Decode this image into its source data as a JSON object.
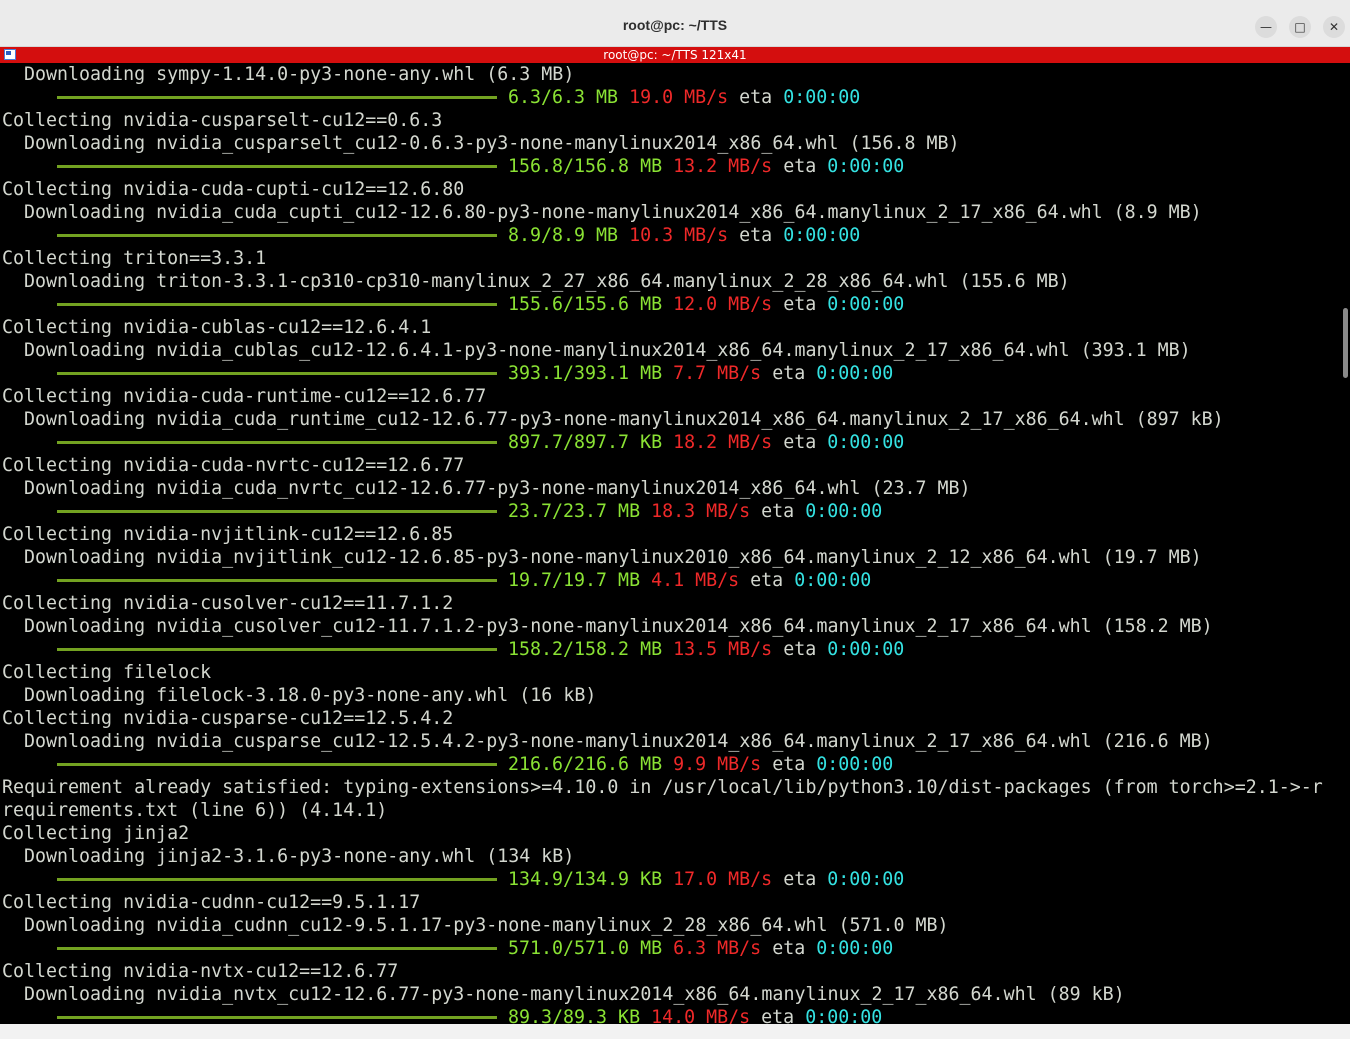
{
  "window": {
    "title": "root@pc: ~/TTS",
    "minimize_symbol": "—",
    "maximize_symbol": "□",
    "close_symbol": "✕"
  },
  "tab": {
    "title": "root@pc: ~/TTS 121x41"
  },
  "colors": {
    "terminal_bg": "#000000",
    "text": "#d3d7cf",
    "progress_green": "#73a221",
    "size_green": "#8ae234",
    "speed_red": "#ef2929",
    "eta_cyan": "#34e2e2",
    "tab_red": "#d40e0e"
  },
  "lines": [
    {
      "type": "text",
      "text": "  Downloading sympy-1.14.0-py3-none-any.whl (6.3 MB)"
    },
    {
      "type": "progress",
      "size": "6.3/6.3 MB",
      "speed": "19.0 MB/s",
      "eta_label": "eta",
      "eta": "0:00:00"
    },
    {
      "type": "text",
      "text": "Collecting nvidia-cusparselt-cu12==0.6.3"
    },
    {
      "type": "text",
      "text": "  Downloading nvidia_cusparselt_cu12-0.6.3-py3-none-manylinux2014_x86_64.whl (156.8 MB)"
    },
    {
      "type": "progress",
      "size": "156.8/156.8 MB",
      "speed": "13.2 MB/s",
      "eta_label": "eta",
      "eta": "0:00:00"
    },
    {
      "type": "text",
      "text": "Collecting nvidia-cuda-cupti-cu12==12.6.80"
    },
    {
      "type": "text",
      "text": "  Downloading nvidia_cuda_cupti_cu12-12.6.80-py3-none-manylinux2014_x86_64.manylinux_2_17_x86_64.whl (8.9 MB)"
    },
    {
      "type": "progress",
      "size": "8.9/8.9 MB",
      "speed": "10.3 MB/s",
      "eta_label": "eta",
      "eta": "0:00:00"
    },
    {
      "type": "text",
      "text": "Collecting triton==3.3.1"
    },
    {
      "type": "text",
      "text": "  Downloading triton-3.3.1-cp310-cp310-manylinux_2_27_x86_64.manylinux_2_28_x86_64.whl (155.6 MB)"
    },
    {
      "type": "progress",
      "size": "155.6/155.6 MB",
      "speed": "12.0 MB/s",
      "eta_label": "eta",
      "eta": "0:00:00"
    },
    {
      "type": "text",
      "text": "Collecting nvidia-cublas-cu12==12.6.4.1"
    },
    {
      "type": "text",
      "text": "  Downloading nvidia_cublas_cu12-12.6.4.1-py3-none-manylinux2014_x86_64.manylinux_2_17_x86_64.whl (393.1 MB)"
    },
    {
      "type": "progress",
      "size": "393.1/393.1 MB",
      "speed": "7.7 MB/s",
      "eta_label": "eta",
      "eta": "0:00:00"
    },
    {
      "type": "text",
      "text": "Collecting nvidia-cuda-runtime-cu12==12.6.77"
    },
    {
      "type": "text",
      "text": "  Downloading nvidia_cuda_runtime_cu12-12.6.77-py3-none-manylinux2014_x86_64.manylinux_2_17_x86_64.whl (897 kB)"
    },
    {
      "type": "progress",
      "size": "897.7/897.7 KB",
      "speed": "18.2 MB/s",
      "eta_label": "eta",
      "eta": "0:00:00"
    },
    {
      "type": "text",
      "text": "Collecting nvidia-cuda-nvrtc-cu12==12.6.77"
    },
    {
      "type": "text",
      "text": "  Downloading nvidia_cuda_nvrtc_cu12-12.6.77-py3-none-manylinux2014_x86_64.whl (23.7 MB)"
    },
    {
      "type": "progress",
      "size": "23.7/23.7 MB",
      "speed": "18.3 MB/s",
      "eta_label": "eta",
      "eta": "0:00:00"
    },
    {
      "type": "text",
      "text": "Collecting nvidia-nvjitlink-cu12==12.6.85"
    },
    {
      "type": "text",
      "text": "  Downloading nvidia_nvjitlink_cu12-12.6.85-py3-none-manylinux2010_x86_64.manylinux_2_12_x86_64.whl (19.7 MB)"
    },
    {
      "type": "progress",
      "size": "19.7/19.7 MB",
      "speed": "4.1 MB/s",
      "eta_label": "eta",
      "eta": "0:00:00"
    },
    {
      "type": "text",
      "text": "Collecting nvidia-cusolver-cu12==11.7.1.2"
    },
    {
      "type": "text",
      "text": "  Downloading nvidia_cusolver_cu12-11.7.1.2-py3-none-manylinux2014_x86_64.manylinux_2_17_x86_64.whl (158.2 MB)"
    },
    {
      "type": "progress",
      "size": "158.2/158.2 MB",
      "speed": "13.5 MB/s",
      "eta_label": "eta",
      "eta": "0:00:00"
    },
    {
      "type": "text",
      "text": "Collecting filelock"
    },
    {
      "type": "text",
      "text": "  Downloading filelock-3.18.0-py3-none-any.whl (16 kB)"
    },
    {
      "type": "text",
      "text": "Collecting nvidia-cusparse-cu12==12.5.4.2"
    },
    {
      "type": "text",
      "text": "  Downloading nvidia_cusparse_cu12-12.5.4.2-py3-none-manylinux2014_x86_64.manylinux_2_17_x86_64.whl (216.6 MB)"
    },
    {
      "type": "progress",
      "size": "216.6/216.6 MB",
      "speed": "9.9 MB/s",
      "eta_label": "eta",
      "eta": "0:00:00"
    },
    {
      "type": "text",
      "text": "Requirement already satisfied: typing-extensions>=4.10.0 in /usr/local/lib/python3.10/dist-packages (from torch>=2.1->-r"
    },
    {
      "type": "text",
      "text": "requirements.txt (line 6)) (4.14.1)"
    },
    {
      "type": "text",
      "text": "Collecting jinja2"
    },
    {
      "type": "text",
      "text": "  Downloading jinja2-3.1.6-py3-none-any.whl (134 kB)"
    },
    {
      "type": "progress",
      "size": "134.9/134.9 KB",
      "speed": "17.0 MB/s",
      "eta_label": "eta",
      "eta": "0:00:00"
    },
    {
      "type": "text",
      "text": "Collecting nvidia-cudnn-cu12==9.5.1.17"
    },
    {
      "type": "text",
      "text": "  Downloading nvidia_cudnn_cu12-9.5.1.17-py3-none-manylinux_2_28_x86_64.whl (571.0 MB)"
    },
    {
      "type": "progress",
      "size": "571.0/571.0 MB",
      "speed": "6.3 MB/s",
      "eta_label": "eta",
      "eta": "0:00:00"
    },
    {
      "type": "text",
      "text": "Collecting nvidia-nvtx-cu12==12.6.77"
    },
    {
      "type": "text",
      "text": "  Downloading nvidia_nvtx_cu12-12.6.77-py3-none-manylinux2014_x86_64.manylinux_2_17_x86_64.whl (89 kB)"
    },
    {
      "type": "progress",
      "size": "89.3/89.3 KB",
      "speed": "14.0 MB/s",
      "eta_label": "eta",
      "eta": "0:00:00"
    }
  ]
}
